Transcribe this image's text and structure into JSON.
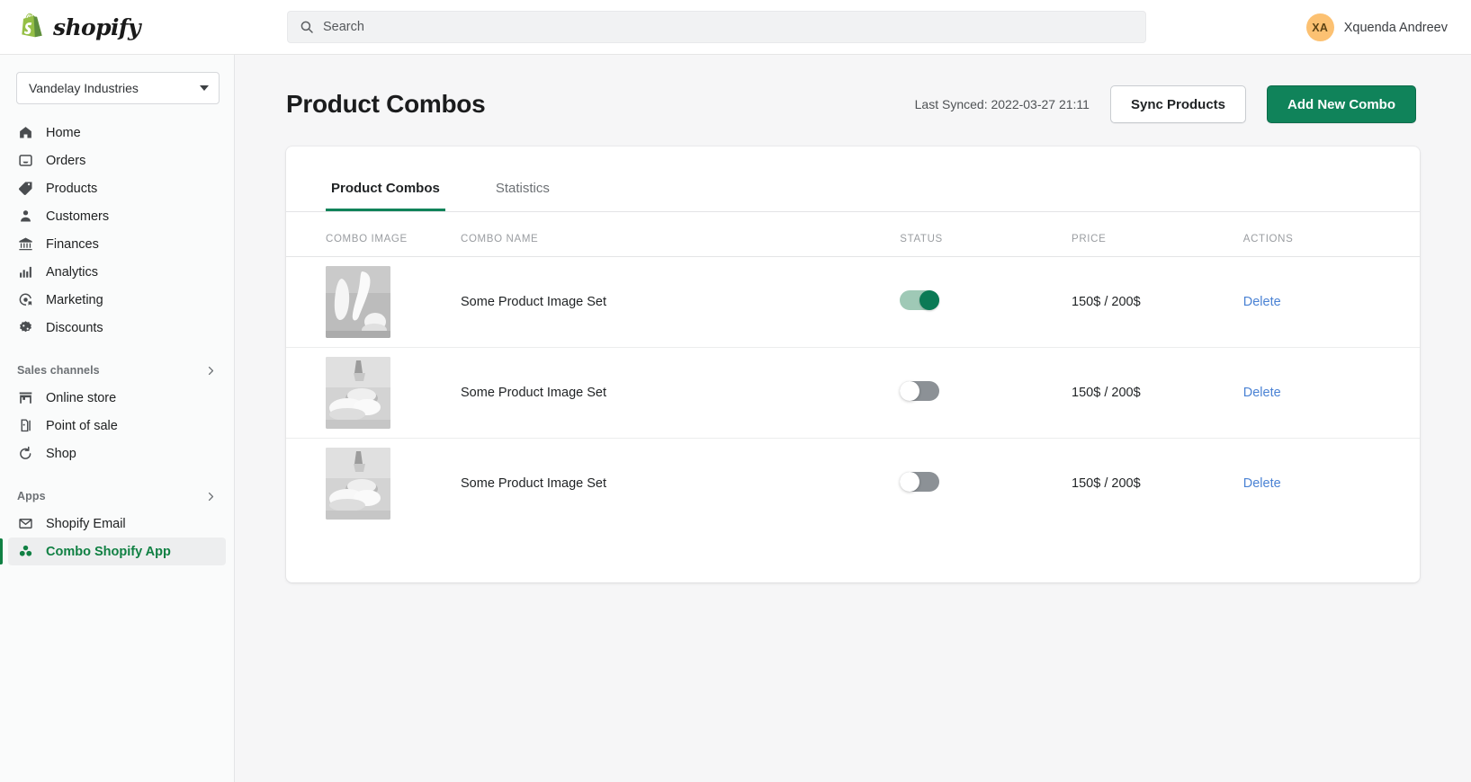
{
  "topbar": {
    "brand_name": "shopify",
    "brand_icon": "shopify-bag-icon",
    "search": {
      "icon": "search-icon",
      "placeholder": "Search",
      "value": ""
    },
    "user": {
      "initials": "XA",
      "name": "Xquenda Andreev"
    }
  },
  "sidebar": {
    "store_switcher": {
      "label": "Vandelay Industries",
      "icon": "chevron-down-icon"
    },
    "items": [
      {
        "label": "Home",
        "icon": "home-icon",
        "active": false
      },
      {
        "label": "Orders",
        "icon": "orders-inbox-icon",
        "active": false
      },
      {
        "label": "Products",
        "icon": "products-tag-icon",
        "active": false
      },
      {
        "label": "Customers",
        "icon": "customers-person-icon",
        "active": false
      },
      {
        "label": "Finances",
        "icon": "finances-bank-icon",
        "active": false
      },
      {
        "label": "Analytics",
        "icon": "analytics-bars-icon",
        "active": false
      },
      {
        "label": "Marketing",
        "icon": "marketing-target-icon",
        "active": false
      },
      {
        "label": "Discounts",
        "icon": "discounts-percent-icon",
        "active": false
      }
    ],
    "sections": [
      {
        "title": "Sales channels",
        "chevron_icon": "chevron-right-icon",
        "items": [
          {
            "label": "Online store",
            "icon": "online-store-icon",
            "active": false
          },
          {
            "label": "Point of sale",
            "icon": "point-of-sale-icon",
            "active": false
          },
          {
            "label": "Shop",
            "icon": "shop-icon",
            "active": false
          }
        ]
      },
      {
        "title": "Apps",
        "chevron_icon": "chevron-right-icon",
        "items": [
          {
            "label": "Shopify Email",
            "icon": "email-envelope-icon",
            "active": false
          },
          {
            "label": "Combo Shopify App",
            "icon": "combo-app-icon",
            "active": true
          }
        ]
      }
    ]
  },
  "page": {
    "title": "Product Combos",
    "last_synced": "Last Synced: 2022-03-27 21:11",
    "sync_button": "Sync Products",
    "add_button": "Add New Combo"
  },
  "card": {
    "tabs": [
      {
        "label": "Product Combos",
        "active": true
      },
      {
        "label": "Statistics",
        "active": false
      }
    ],
    "table": {
      "columns": [
        "COMBO IMAGE",
        "COMBO NAME",
        "STATUS",
        "PRICE",
        "ACTIONS"
      ],
      "rows": [
        {
          "image_alt": "product-combo-thumbnail",
          "name": "Some Product Image Set",
          "status_on": true,
          "status_label": "enabled",
          "price": "150$ / 200$",
          "action": "Delete"
        },
        {
          "image_alt": "product-combo-thumbnail",
          "name": "Some Product Image Set",
          "status_on": false,
          "status_label": "disabled",
          "price": "150$ / 200$",
          "action": "Delete"
        },
        {
          "image_alt": "product-combo-thumbnail",
          "name": "Some Product Image Set",
          "status_on": false,
          "status_label": "disabled",
          "price": "150$ / 200$",
          "action": "Delete"
        }
      ]
    }
  },
  "colors": {
    "brand_green": "#10835a",
    "active_nav_green": "#108043",
    "link_blue": "#4a82d4",
    "avatar_bg": "#fcc172",
    "toggle_on_track": "#9fc9b6",
    "toggle_on_knob": "#0b7a55",
    "toggle_off_track": "#8c9196",
    "canvas_bg": "#f6f6f7",
    "sidebar_bg": "#fafbfb"
  }
}
